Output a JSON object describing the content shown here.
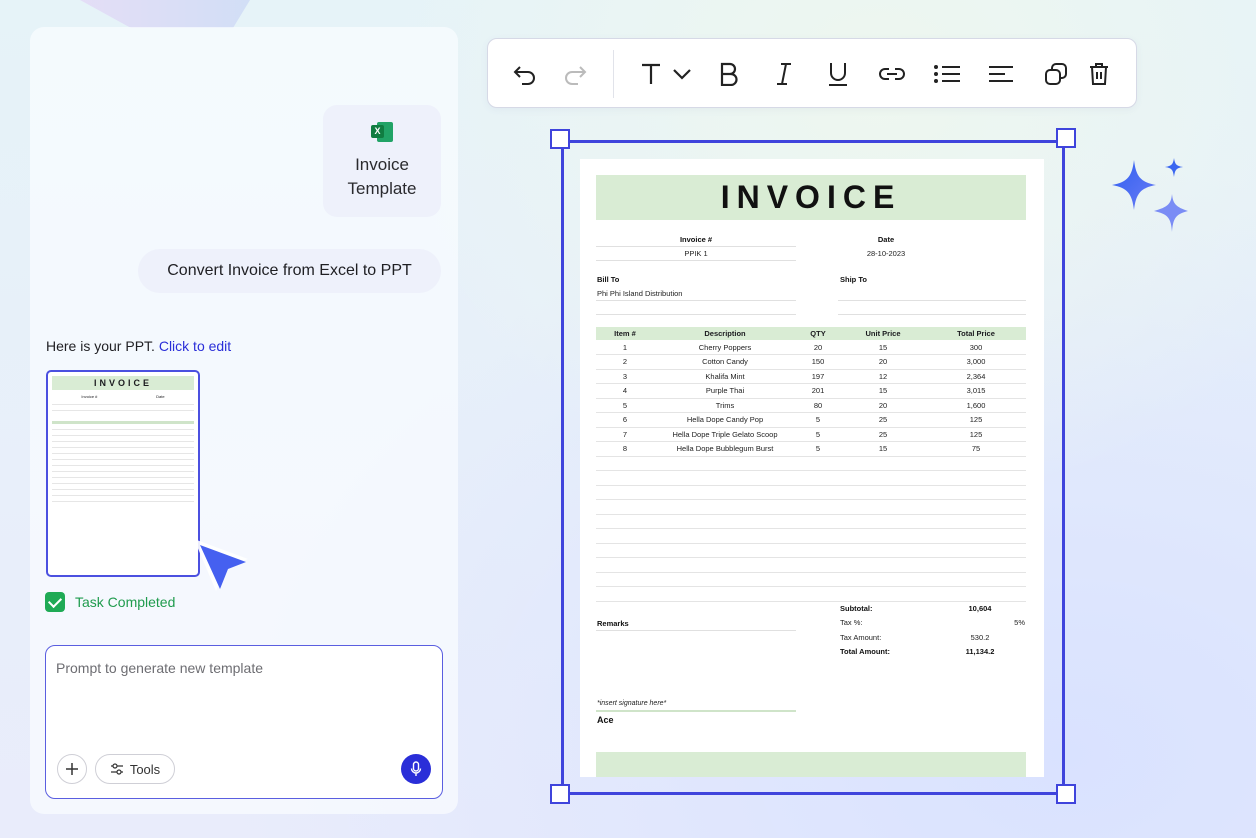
{
  "chat": {
    "attachment": {
      "name": "Invoice\nTemplate",
      "icon": "excel-icon"
    },
    "user_message": "Convert Invoice from Excel to PPT",
    "reply_prefix": "Here is your PPT.",
    "reply_link": "Click to edit",
    "task_status": "Task Completed",
    "prompt_placeholder": "Prompt to generate new template",
    "tools_label": "Tools"
  },
  "toolbar": {
    "buttons": [
      "undo-icon",
      "redo-icon",
      "text-icon",
      "chevron-down-icon",
      "bold-icon",
      "italic-icon",
      "underline-icon",
      "link-icon",
      "list-icon",
      "align-left-icon",
      "duplicate-icon",
      "trash-icon"
    ]
  },
  "invoice": {
    "title": "INVOICE",
    "invoice_no_label": "Invoice #",
    "invoice_no": "PPIK 1",
    "date_label": "Date",
    "date": "28-10-2023",
    "bill_to_label": "Bill To",
    "bill_to": "Phi Phi Island Distribution",
    "ship_to_label": "Ship To",
    "columns": [
      "Item #",
      "Description",
      "QTY",
      "Unit Price",
      "Total Price"
    ],
    "rows": [
      [
        "1",
        "Cherry Poppers",
        "20",
        "15",
        "300"
      ],
      [
        "2",
        "Cotton Candy",
        "150",
        "20",
        "3,000"
      ],
      [
        "3",
        "Khalifa Mint",
        "197",
        "12",
        "2,364"
      ],
      [
        "4",
        "Purple Thai",
        "201",
        "15",
        "3,015"
      ],
      [
        "5",
        "Trims",
        "80",
        "20",
        "1,600"
      ],
      [
        "6",
        "Hella Dope Candy Pop",
        "5",
        "25",
        "125"
      ],
      [
        "7",
        "Hella Dope Triple Gelato Scoop",
        "5",
        "25",
        "125"
      ],
      [
        "8",
        "Hella Dope Bubblegum Burst",
        "5",
        "15",
        "75"
      ]
    ],
    "subtotal_label": "Subtotal:",
    "subtotal": "10,604",
    "tax_pct_label": "Tax %:",
    "tax_pct": "5%",
    "tax_amount_label": "Tax Amount:",
    "tax_amount": "530.2",
    "total_label": "Total Amount:",
    "total": "11,134.2",
    "remarks_label": "Remarks",
    "signature_placeholder": "*insert signature here*",
    "signature_name": "Ace"
  },
  "colors": {
    "accent": "#3f44dc",
    "invoice_green": "#d9ecd4",
    "success": "#1faa55",
    "mic": "#2a2ed8"
  }
}
